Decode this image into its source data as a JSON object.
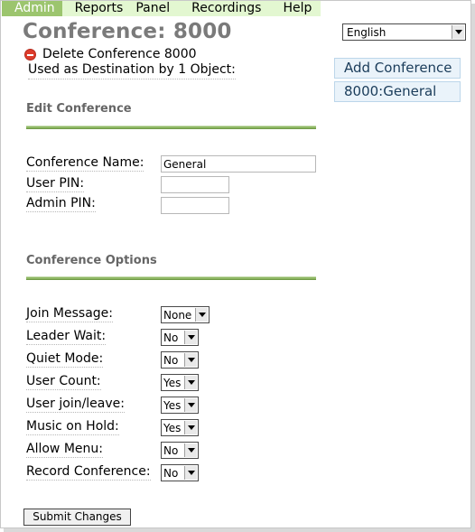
{
  "nav": {
    "items": [
      "Admin",
      "Reports",
      "Panel",
      "Recordings",
      "Help"
    ]
  },
  "page": {
    "title": "Conference: 8000",
    "delete_label": "Delete Conference 8000",
    "used_as": "Used as Destination by 1 Object:"
  },
  "edit_section": {
    "title": "Edit Conference",
    "name_label": "Conference Name:",
    "name_value": "General",
    "user_pin_label": "User PIN:",
    "user_pin_value": "",
    "admin_pin_label": "Admin PIN:",
    "admin_pin_value": ""
  },
  "options_section": {
    "title": "Conference Options",
    "rows": [
      {
        "label": "Join Message:",
        "value": "None"
      },
      {
        "label": "Leader Wait:",
        "value": "No"
      },
      {
        "label": "Quiet Mode:",
        "value": "No"
      },
      {
        "label": "User Count:",
        "value": "Yes"
      },
      {
        "label": "User join/leave:",
        "value": "Yes"
      },
      {
        "label": "Music on Hold:",
        "value": "Yes"
      },
      {
        "label": "Allow Menu:",
        "value": "No"
      },
      {
        "label": "Record Conference:",
        "value": "No"
      }
    ]
  },
  "sidebar": {
    "language": "English",
    "add_label": "Add Conference",
    "items": [
      "8000:General"
    ]
  },
  "submit_label": "Submit Changes",
  "colors": {
    "nav_bg": "#e3f7d1",
    "nav_active": "#9cc56e",
    "rule": "#8eb764",
    "side_btn_bg": "#eaf3fa"
  }
}
